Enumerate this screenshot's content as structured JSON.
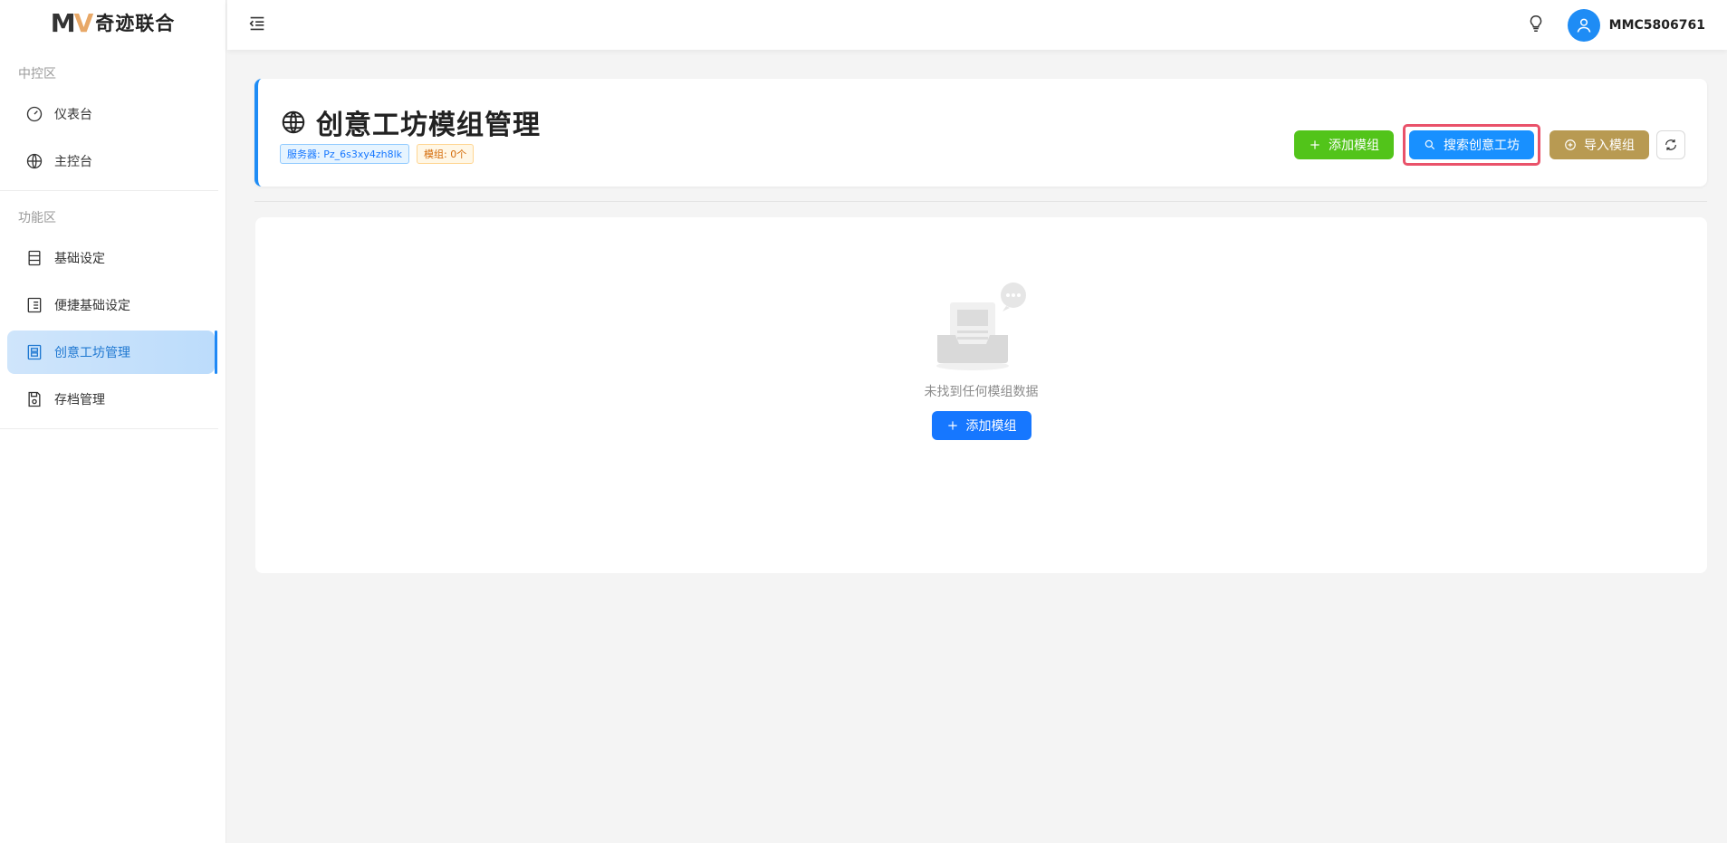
{
  "app": {
    "logo_mark_m": "M",
    "logo_mark_v": "V",
    "logo_text": "奇迹联合"
  },
  "sidebar": {
    "sections": [
      {
        "label": "中控区",
        "items": [
          {
            "label": "仪表台",
            "icon": "dashboard-icon"
          },
          {
            "label": "主控台",
            "icon": "globe-icon"
          }
        ]
      },
      {
        "label": "功能区",
        "items": [
          {
            "label": "基础设定",
            "icon": "server-icon"
          },
          {
            "label": "便捷基础设定",
            "icon": "list-icon"
          },
          {
            "label": "创意工坊管理",
            "icon": "workshop-icon",
            "active": true
          },
          {
            "label": "存档管理",
            "icon": "save-icon"
          }
        ]
      }
    ]
  },
  "topbar": {
    "username": "MMC5806761"
  },
  "header": {
    "title": "创意工坊模组管理",
    "server_tag": "服务器: Pz_6s3xy4zh8lk",
    "mod_count_tag": "模组: 0个",
    "add_button": "添加模组",
    "search_button": "搜索创意工坊",
    "import_button": "导入模组"
  },
  "content": {
    "empty_text": "未找到任何模组数据",
    "add_button": "添加模组"
  },
  "colors": {
    "accent": "#1890ff",
    "green": "#52c41a",
    "gold": "#b89a52",
    "highlight": "#e9526a"
  }
}
